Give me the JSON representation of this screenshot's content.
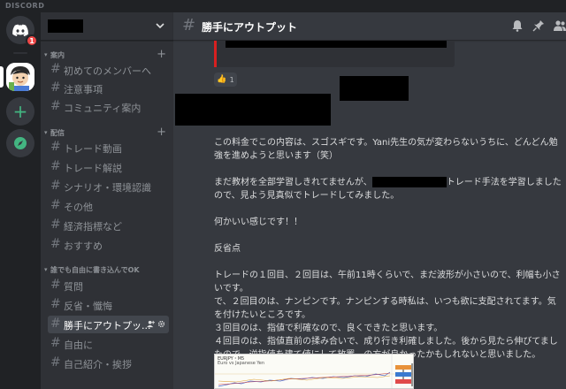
{
  "titlebar": {
    "brand": "DISCORD"
  },
  "rail": {
    "home_badge": "1"
  },
  "server": {
    "categories": [
      {
        "label": "案内",
        "channels": [
          "初めてのメンバーへ",
          "注意事項",
          "コミュニティ案内"
        ]
      },
      {
        "label": "配信",
        "channels": [
          "トレード動画",
          "トレード解説",
          "シナリオ・環境認識",
          "その他",
          "経済指標など",
          "おすすめ"
        ]
      },
      {
        "label": "誰でも自由に書き込んでOK",
        "channels": [
          "質問",
          "反省・懺悔",
          "勝手にアウトプッ...",
          "自由に",
          "自己紹介・挨拶"
        ]
      }
    ]
  },
  "chat": {
    "title": "勝手にアウトプット",
    "reaction": {
      "emoji": "👍",
      "count": "1"
    },
    "message": {
      "line1": "この料金でこの内容は、スゴスギです。Yani先生の気が変わらないうちに、どんどん勉強を進めようと思います（笑）",
      "line2_pre": "まだ教材を全部学習しきれてませんが、",
      "line2_post": "トレード手法を学習しましたので、見よう見真似でトレードしてみました。",
      "line3": "何かいい感じです！！",
      "line4": "反省点",
      "line5": "トレードの１回目、２回目は、午前11時くらいで、まだ波形が小さいので、利幅も小さいです。",
      "line6": "で、２回目のは、ナンピンです。ナンピンする時私は、いつも欲に支配されてます。気を付けたいところです。",
      "line7": "３回目のは、指値で利確なので、良くできたと思います。",
      "line8": "４回目のは、指値直前の揉み合いで、成り行き利確しました。後から見たら伸びてましたので、逆指値を建て値にして放置、の方が良かったかもしれないと思いました。"
    },
    "chart_thumb": {
      "title": "EURJPY・M5",
      "subtitle": "Euro vs Japanese Yen"
    }
  },
  "colors": {
    "rail_bg": "#202225",
    "sidebar_bg": "#2f3136",
    "chat_bg": "#36393f",
    "accent_green": "#43b581",
    "badge_red": "#f04747",
    "embed_bar": "#d82020"
  }
}
